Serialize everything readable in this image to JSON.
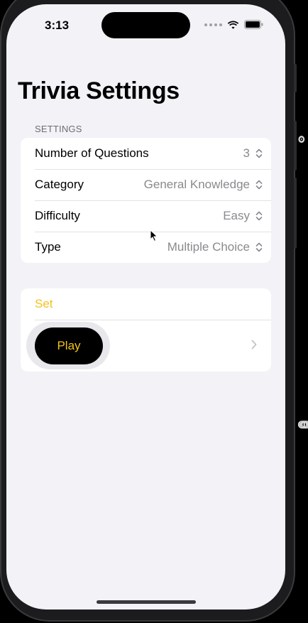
{
  "status_bar": {
    "time": "3:13",
    "icons": [
      "dots-icon",
      "wifi-icon",
      "battery-icon"
    ]
  },
  "page": {
    "title": "Trivia Settings",
    "section_header": "SETTINGS"
  },
  "settings": [
    {
      "label": "Number of Questions",
      "value": "3"
    },
    {
      "label": "Category",
      "value": "General Knowledge"
    },
    {
      "label": "Difficulty",
      "value": "Easy"
    },
    {
      "label": "Type",
      "value": "Multiple Choice"
    }
  ],
  "actions": {
    "set_label": "Set",
    "play_label": "Play"
  },
  "edge_glyphs": [
    "ʘ",
    "ↈP"
  ],
  "colors": {
    "accent": "#f3c21b",
    "background": "#f2f2f7",
    "secondary_text": "#8a8a8e",
    "play_button": "#000000"
  }
}
